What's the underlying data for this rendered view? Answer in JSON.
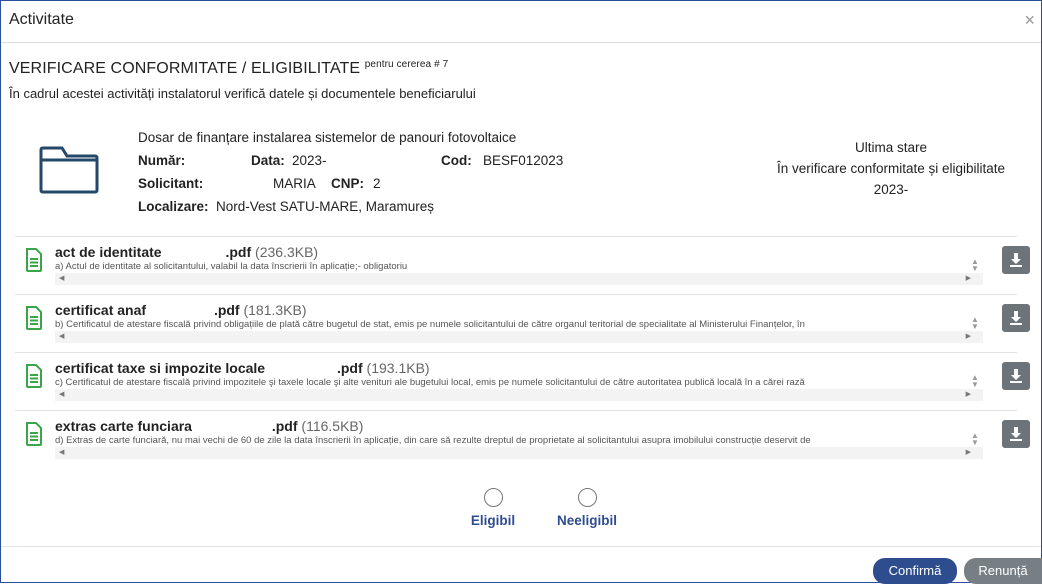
{
  "modal": {
    "title": "Activitate",
    "close": "×"
  },
  "header": {
    "title": "VERIFICARE CONFORMITATE / ELIGIBILITATE",
    "suffix": "pentru cererea # 7",
    "description": "În cadrul acestei activități instalatorul verifică datele și documentele beneficiarului"
  },
  "dosar": {
    "title": "Dosar de finanțare instalarea sistemelor de panouri fotovoltaice",
    "numar_label": "Număr:",
    "data_label": "Data:",
    "data_value": "2023-",
    "cod_label": "Cod:",
    "cod_value": "BESF012023",
    "solicitant_label": "Solicitant:",
    "solicitant_value": "MARIA",
    "cnp_label": "CNP:",
    "cnp_value": "2",
    "localizare_label": "Localizare:",
    "localizare_value": "Nord-Vest SATU-MARE,  Maramureș"
  },
  "status": {
    "title": "Ultima stare",
    "value": "În verificare conformitate și eligibilitate",
    "date": "2023-"
  },
  "documents": [
    {
      "name": "act de identitate",
      "ext": ".pdf",
      "size": "(236.3KB)",
      "desc": "a) Actul de identitate al solicitantului, valabil la data înscrierii în aplicație;- obligatoriu"
    },
    {
      "name": "certificat anaf",
      "ext": ".pdf",
      "size": "(181.3KB)",
      "desc": "b) Certificatul de atestare fiscală privind obligațiile de plată către bugetul de stat, emis pe numele solicitantului de către organul teritorial de specialitate al Ministerului Finanțelor, în"
    },
    {
      "name": "certificat taxe si impozite locale",
      "ext": ".pdf",
      "size": "(193.1KB)",
      "desc": "c) Certificatul de atestare fiscală privind impozitele şi taxele locale şi alte venituri ale bugetului local, emis pe numele solicitantului de către autoritatea publică locală în a cărei rază"
    },
    {
      "name": "extras carte funciara",
      "ext": ".pdf",
      "size": "(116.5KB)",
      "desc": "d) Extras de carte funciară, nu mai vechi de 60 de zile la data înscrierii în aplicație, din care să rezulte dreptul de proprietate al solicitantului asupra imobilului construcție deservit de"
    }
  ],
  "options": {
    "eligibil": "Eligibil",
    "neeligibil": "Neeligibil"
  },
  "buttons": {
    "confirm": "Confirmă",
    "cancel": "Renunță"
  },
  "icons": {
    "document": "file-text-icon",
    "download": "download-icon",
    "folder": "folder-icon"
  },
  "colors": {
    "primary": "#2e4d8f",
    "secondary": "#777e84",
    "doc_icon": "#3aa64a",
    "download_bg": "#6c7479"
  }
}
